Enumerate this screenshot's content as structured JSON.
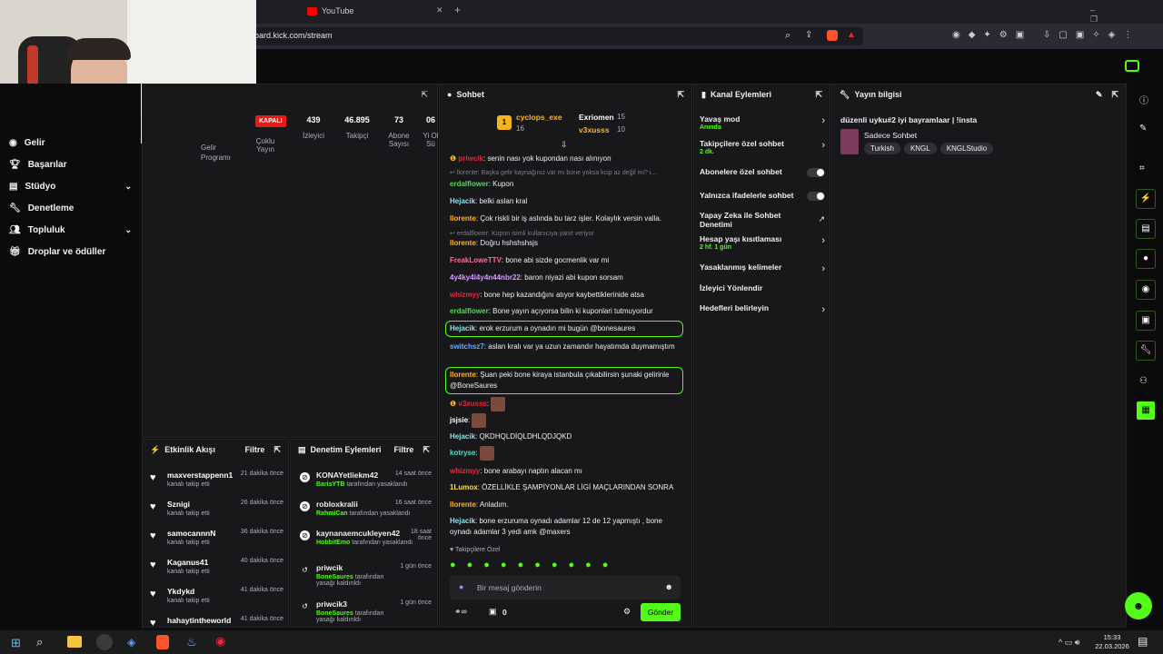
{
  "browser": {
    "tab_title": "YouTube",
    "url": "oard.kick.com/stream"
  },
  "sidebar": {
    "items": [
      {
        "label": "Gelir",
        "icon": "coin-icon",
        "chevron": false
      },
      {
        "label": "Başarılar",
        "icon": "trophy-icon",
        "chevron": false
      },
      {
        "label": "Stüdyo",
        "icon": "studio-icon",
        "chevron": true
      },
      {
        "label": "Denetleme",
        "icon": "wrench-icon",
        "chevron": false
      },
      {
        "label": "Topluluk",
        "icon": "people-icon",
        "chevron": true
      },
      {
        "label": "Droplar ve ödüller",
        "icon": "gift-icon",
        "chevron": false
      }
    ]
  },
  "stats": {
    "status_badge": "KAPALI",
    "revenue_label": "Gelir Programı",
    "items": [
      {
        "value": "",
        "label": "Çoklu Yayın"
      },
      {
        "value": "439",
        "label": "İzleyici"
      },
      {
        "value": "46.895",
        "label": "Takipçi"
      },
      {
        "value": "73",
        "label": "Abone Sayısı"
      },
      {
        "value": "06",
        "label": "Yi Ol Sü"
      }
    ]
  },
  "activity": {
    "title": "Etkinlik Akışı",
    "filter": "Filtre",
    "items": [
      {
        "name": "maxverstappenn1",
        "sub": "kanalı takip etti",
        "time": "21 dakika önce"
      },
      {
        "name": "Sznigi",
        "sub": "kanalı takip etti",
        "time": "26 dakika önce"
      },
      {
        "name": "samocannnN",
        "sub": "kanalı takip etti",
        "time": "36 dakika önce"
      },
      {
        "name": "Kaganus41",
        "sub": "kanalı takip etti",
        "time": "40 dakika önce"
      },
      {
        "name": "Ykdykd",
        "sub": "kanalı takip etti",
        "time": "41 dakika önce"
      },
      {
        "name": "hahaytintheworld",
        "sub": "",
        "time": "41 dakika önce"
      }
    ]
  },
  "modlog": {
    "title": "Denetim Eylemleri",
    "filter": "Filtre",
    "items": [
      {
        "name": "KONAYetliekm42",
        "by": "BarisYTB",
        "action": "tarafından yasaklandı",
        "time": "14 saat önce",
        "icon": "ban-icon"
      },
      {
        "name": "robloxkralii",
        "by": "RahmiCan",
        "action": "tarafından yasaklandı",
        "time": "16 saat önce",
        "icon": "ban-icon"
      },
      {
        "name": "kaynanaemcukleyen42",
        "by": "HobbitEmo",
        "action": "tarafından yasaklandı",
        "time": "18 saat önce",
        "icon": "ban-icon"
      },
      {
        "name": "priwcik",
        "by": "BoneSaures",
        "action": "tarafından yasağı kaldırıldı",
        "time": "1 gün önce",
        "icon": "undo-icon"
      },
      {
        "name": "priwcik3",
        "by": "BoneSaures",
        "action": "tarafından yasağı kaldırıldı",
        "time": "1 gün önce",
        "icon": "undo-icon"
      }
    ]
  },
  "chat": {
    "title": "Sohbet",
    "top": [
      {
        "name": "cyclops_exe",
        "count": "16"
      },
      {
        "name": "Exriomen",
        "count": "15"
      },
      {
        "name": "v3xusss",
        "count": "10"
      }
    ],
    "messages": [
      {
        "user": "priwcik",
        "color": "#e6283c",
        "text": "senin nası yok kupondan nası alınıyon"
      },
      {
        "reply": "llorente: Başka gelir kaynağınız var mı bone yoksa kcip az değil mi? i..."
      },
      {
        "user": "erdalflower",
        "color": "#5ad25a",
        "text": "Kupon"
      },
      {
        "user": "Hejacik",
        "color": "#8fe3e8",
        "text": "belki aslan kral"
      },
      {
        "user": "llorente",
        "color": "#ffb32b",
        "text": "Çok riskli bir iş aslında bu tarz işler. Kolaylık versin valla."
      },
      {
        "reply": "erdalflower: Kupon isimli kullanıcıya yanıt veriyor"
      },
      {
        "user": "llorente",
        "color": "#ffb32b",
        "text": "Doğru hshshshsjs"
      },
      {
        "user": "FreakLoweTTV",
        "color": "#ff6a9a",
        "text": "bone abi sizde gocmenlik var mi"
      },
      {
        "user": "4y4ky4l4y4n44nbr22",
        "color": "#d49cff",
        "text": "baron niyazi abi kupon sorsam"
      },
      {
        "user": "whizmyy",
        "color": "#e6283c",
        "text": "bone hep kazandığını atıyor kaybettiklerinide atsa"
      },
      {
        "user": "erdalflower",
        "color": "#5ad25a",
        "text": "Bone yayın açıyorsa bilin ki kuponlari tutmuyordur"
      },
      {
        "user": "Hejacik",
        "color": "#8fe3e8",
        "text": "erok erzurum a oynadın mi bugün @bonesaures"
      },
      {
        "user": "switchsz7",
        "color": "#6aa9ff",
        "text": "aslan kralı var ya uzun zamandır hayatımda duymamıştım"
      },
      {
        "user": "llorente",
        "color": "#ffb32b",
        "text": "Şuan peki bone kiraya istanbula çıkabilirsin şunaki gelirinle @BoneSaures"
      },
      {
        "user": "v3xusss",
        "color": "#e6283c",
        "text": ""
      },
      {
        "user": "jsjsie",
        "color": "#ffffff",
        "text": ""
      },
      {
        "user": "Hejacik",
        "color": "#8fe3e8",
        "text": "QKDHQLDİQLDHLQDJQKD"
      },
      {
        "user": "kotryse",
        "color": "#45e6c4",
        "text": ""
      },
      {
        "user": "whizmyy",
        "color": "#e6283c",
        "text": "bone arabayı naptın alacan mı"
      },
      {
        "user": "1Lumox",
        "color": "#ffe14a",
        "text": "ÖZELLİKLE ŞAMPİYONLAR LİGİ MAÇLARINDAN SONRA"
      },
      {
        "user": "llorente",
        "color": "#ffb32b",
        "text": "Anladım."
      },
      {
        "user": "Hejacik",
        "color": "#8fe3e8",
        "text": "bone erzuruma oynadı adamlar 12 de 12 yapmıştı , bone oynadı adamlar 3 yedi amk @maxers"
      }
    ],
    "followers_only": "Takipçilere Özel",
    "input_placeholder": "Bir mesaj gönderin",
    "points": "0",
    "send": "Gönder"
  },
  "channel_actions": {
    "title": "Kanal Eylemleri",
    "items": [
      {
        "label": "Yavaş mod",
        "sub": "Anında",
        "control": "arrow"
      },
      {
        "label": "Takipçilere özel sohbet",
        "sub": "2 dk.",
        "control": "arrow"
      },
      {
        "label": "Abonelere özel sohbet",
        "sub": "",
        "control": "toggle"
      },
      {
        "label": "Yalnızca ifadelerle sohbet",
        "sub": "",
        "control": "toggle"
      },
      {
        "label": "Yapay Zeka ile Sohbet Denetimi",
        "sub": "",
        "control": "external"
      },
      {
        "label": "Hesap yaşı kısıtlaması",
        "sub": "2 hf. 1 gün",
        "control": "arrow"
      },
      {
        "label": "Yasaklanmış kelimeler",
        "sub": "",
        "control": "arrow"
      },
      {
        "label": "İzleyici Yönlendir",
        "sub": "",
        "control": "none"
      },
      {
        "label": "Hedefleri belirleyin",
        "sub": "",
        "control": "arrow"
      }
    ]
  },
  "stream_info": {
    "title": "Yayın bilgisi",
    "stream_title": "düzenli uyku#2 iyi bayramlaar | !insta",
    "category": "Sadece Sohbet",
    "tags": [
      "Turkish",
      "KNGL",
      "KNGLStudio"
    ]
  },
  "taskbar": {
    "time": "15:33",
    "date": "22.03.2026"
  },
  "colors": {
    "accent": "#53fc18",
    "panel": "#18181b",
    "bg": "#0e0e10"
  }
}
